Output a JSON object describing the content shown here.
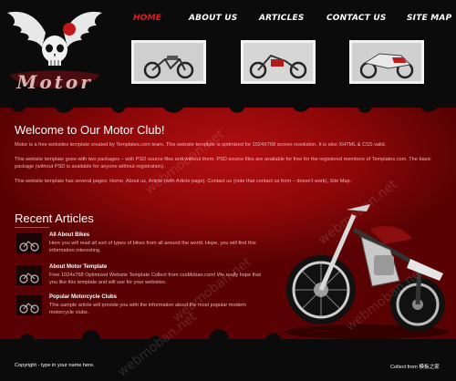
{
  "nav": {
    "items": [
      {
        "label": "HOME",
        "active": true
      },
      {
        "label": "ABOUT US",
        "active": false
      },
      {
        "label": "ARTICLES",
        "active": false
      },
      {
        "label": "CONTACT US",
        "active": false
      },
      {
        "label": "SITE MAP",
        "active": false
      }
    ]
  },
  "logo": {
    "text": "Motor"
  },
  "welcome": {
    "title": "Welcome to Our Motor Club!",
    "paragraphs": [
      "Motor is a free websites template created by Templates.com team. This website template is optimized for 1024X768 screen resolution. It is also XHTML & CSS valid.",
      "This website template goes with two packages – with PSD source files and without them. PSD source files are available for free for the registered members of Templates.com. The basic package (without PSD is available for anyone without registration).",
      "This website template has several pages: Home, About us, Article (with Article page), Contact us (note that contact us form – doesn't work), Site Map."
    ]
  },
  "recent": {
    "title": "Recent Articles",
    "articles": [
      {
        "title": "All About Bikes",
        "text": "Here you will read all sort of types of bikes from all around the world. Hope, you will find this information interesting."
      },
      {
        "title": "About Motor Template",
        "text": "Free 1024x768 Optimized Website Template Collect from cssMoban.com! We really hope that you like this template and will use for your websites."
      },
      {
        "title": "Popular Motorcycle Clubs",
        "text": "This sample article will provide you with the information about the most popular modern motorcycle clubs."
      }
    ]
  },
  "footer": {
    "copyright": "Copyright - type in your name here.",
    "collect": "Collect from 模板之家"
  },
  "watermark": "webmoban.net",
  "colors": {
    "accent": "#e11b1b",
    "background": "#8e0708",
    "band": "#0b0b0b"
  }
}
